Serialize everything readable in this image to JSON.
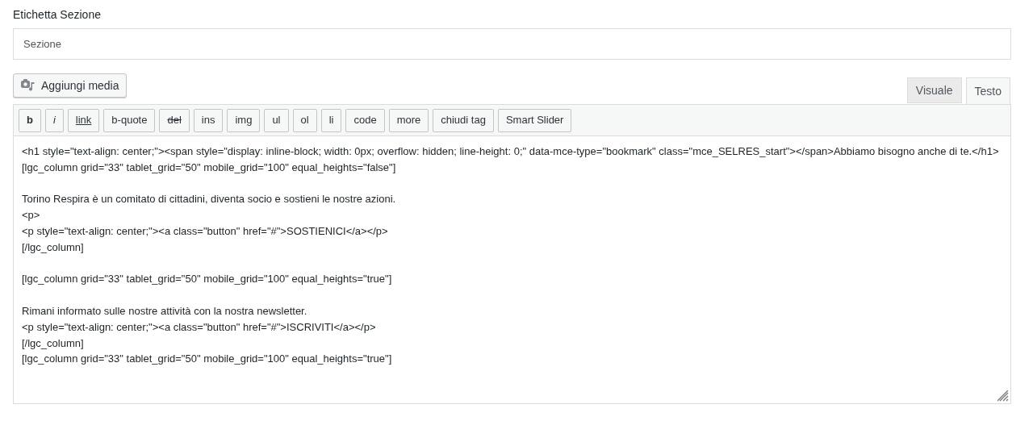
{
  "section_label": "Etichetta Sezione",
  "section_field": {
    "placeholder": "Sezione"
  },
  "add_media_button": "Aggiungi media",
  "tabs": [
    {
      "label": "Visuale",
      "selected": false
    },
    {
      "label": "Testo",
      "selected": true
    }
  ],
  "toolbar_buttons": [
    {
      "label": "b",
      "kind": "bold"
    },
    {
      "label": "i",
      "kind": "italic"
    },
    {
      "label": "link",
      "kind": "underline"
    },
    {
      "label": "b-quote",
      "kind": "plain"
    },
    {
      "label": "del",
      "kind": "strike"
    },
    {
      "label": "ins",
      "kind": "plain"
    },
    {
      "label": "img",
      "kind": "plain"
    },
    {
      "label": "ul",
      "kind": "plain"
    },
    {
      "label": "ol",
      "kind": "plain"
    },
    {
      "label": "li",
      "kind": "plain"
    },
    {
      "label": "code",
      "kind": "plain"
    },
    {
      "label": "more",
      "kind": "plain"
    },
    {
      "label": "chiudi tag",
      "kind": "plain"
    },
    {
      "label": "Smart Slider",
      "kind": "plain"
    }
  ],
  "editor_blocks": [
    [
      "<h1 style=\"text-align: center;\"><span style=\"display: inline-block; width: 0px; overflow: hidden; line-height: 0;\" data-mce-type=\"bookmark\" class=\"mce_SELRES_start\"></span>Abbiamo bisogno anche di te.</h1>",
      "[lgc_column grid=\"33\" tablet_grid=\"50\" mobile_grid=\"100\" equal_heights=\"false\"]"
    ],
    [
      "Torino Respira è un comitato di cittadini, diventa socio e sostieni le nostre azioni.",
      "<p>",
      "<p style=\"text-align: center;\"><a class=\"button\" href=\"#\">SOSTIENICI</a></p>",
      "[/lgc_column]"
    ],
    [
      "[lgc_column grid=\"33\" tablet_grid=\"50\" mobile_grid=\"100\" equal_heights=\"true\"]"
    ],
    [
      "Rimani informato sulle nostre attività con la nostra newsletter.",
      "<p style=\"text-align: center;\"><a class=\"button\" href=\"#\">ISCRIVITI</a></p>",
      "[/lgc_column]",
      "[lgc_column grid=\"33\" tablet_grid=\"50\" mobile_grid=\"100\" equal_heights=\"true\"]"
    ]
  ]
}
